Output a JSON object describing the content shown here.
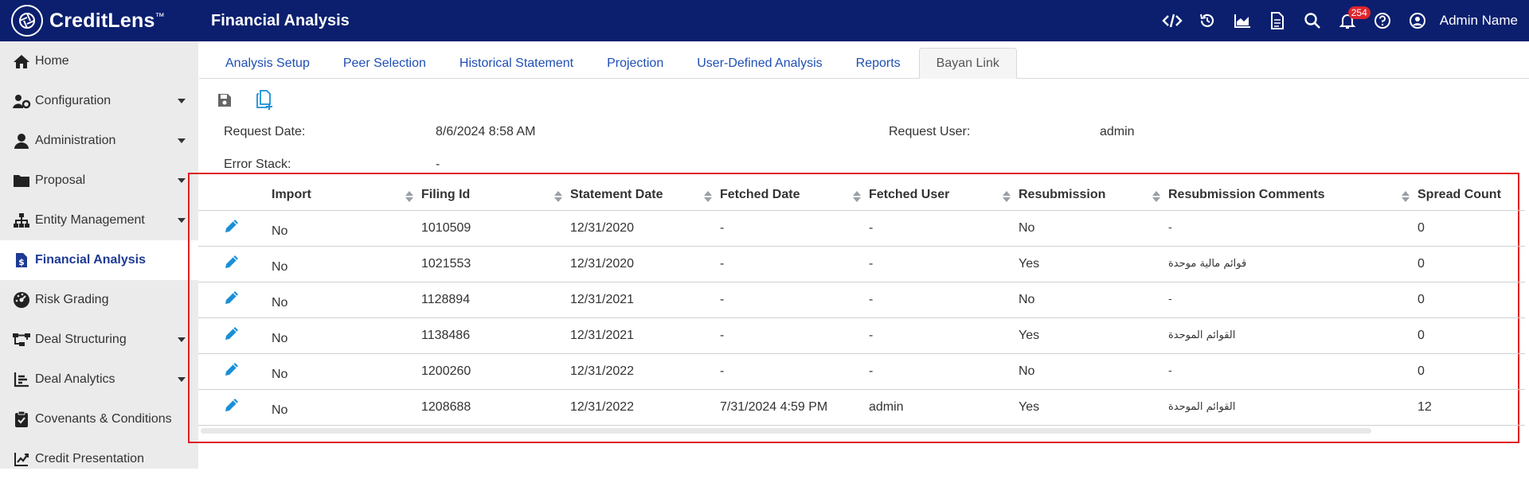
{
  "app": {
    "name": "CreditLens",
    "tm": "™",
    "page_title": "Financial Analysis"
  },
  "header": {
    "notification_count": "254",
    "user_name": "Admin Name",
    "icons": [
      "code-icon",
      "history-icon",
      "chart-icon",
      "document-icon",
      "search-icon",
      "bell-icon",
      "help-icon",
      "user-icon"
    ]
  },
  "sidebar": {
    "items": [
      {
        "label": "Home",
        "icon": "home-icon"
      },
      {
        "label": "Configuration",
        "icon": "user-gear-icon"
      },
      {
        "label": "Administration",
        "icon": "user-icon"
      },
      {
        "label": "Proposal",
        "icon": "folder-icon"
      },
      {
        "label": "Entity Management",
        "icon": "hierarchy-icon"
      },
      {
        "label": "Financial Analysis",
        "icon": "dollar-document-icon"
      },
      {
        "label": "Risk Grading",
        "icon": "gauge-icon"
      },
      {
        "label": "Deal Structuring",
        "icon": "structure-icon"
      },
      {
        "label": "Deal Analytics",
        "icon": "bar-chart-icon"
      },
      {
        "label": "Covenants & Conditions",
        "icon": "clipboard-check-icon"
      },
      {
        "label": "Credit Presentation",
        "icon": "presentation-icon"
      }
    ]
  },
  "tabs": [
    "Analysis Setup",
    "Peer Selection",
    "Historical Statement",
    "Projection",
    "User-Defined Analysis",
    "Reports",
    "Bayan Link"
  ],
  "info": {
    "request_date_label": "Request Date:",
    "request_date_value": "8/6/2024 8:58 AM",
    "request_user_label": "Request User:",
    "request_user_value": "admin",
    "error_stack_label": "Error Stack:",
    "error_stack_value": "-"
  },
  "table": {
    "headers": [
      "Import",
      "Filing Id",
      "Statement Date",
      "Fetched Date",
      "Fetched User",
      "Resubmission",
      "Resubmission Comments",
      "Spread Count"
    ],
    "rows": [
      [
        "No",
        "1010509",
        "12/31/2020",
        "-",
        "-",
        "No",
        "-",
        "0"
      ],
      [
        "No",
        "1021553",
        "12/31/2020",
        "-",
        "-",
        "Yes",
        "قوائم مالية موحدة",
        "0"
      ],
      [
        "No",
        "1128894",
        "12/31/2021",
        "-",
        "-",
        "No",
        "-",
        "0"
      ],
      [
        "No",
        "1138486",
        "12/31/2021",
        "-",
        "-",
        "Yes",
        "القوائم الموحدة",
        "0"
      ],
      [
        "No",
        "1200260",
        "12/31/2022",
        "-",
        "-",
        "No",
        "-",
        "0"
      ],
      [
        "No",
        "1208688",
        "12/31/2022",
        "7/31/2024 4:59 PM",
        "admin",
        "Yes",
        "القوائم الموحدة",
        "12"
      ]
    ]
  },
  "colors": {
    "header_bg": "#0b1f6e",
    "link": "#1f4fb4",
    "highlight_frame": "#e02020",
    "edit_icon": "#1a8fd6",
    "badge": "#e0252d"
  }
}
